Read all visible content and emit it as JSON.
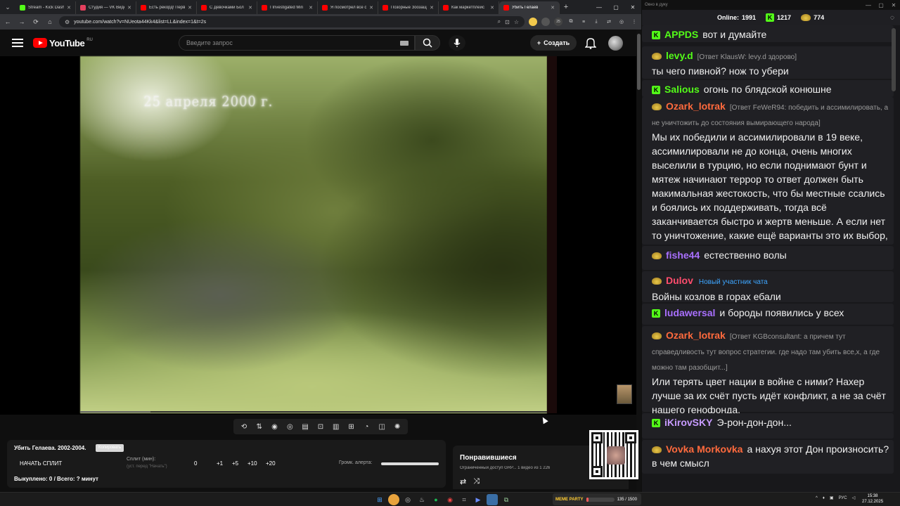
{
  "browser": {
    "tabs": [
      {
        "title": "Stream - Kick Dashboard",
        "color": "#53fc18"
      },
      {
        "title": "Студия — VK Видео",
        "color": "#e5405e"
      },
      {
        "title": "Есть рекорд! Перв",
        "color": "#ff0000"
      },
      {
        "title": "С Девочками Бол",
        "color": "#ff0000"
      },
      {
        "title": "I Investigated Min",
        "color": "#ff0000"
      },
      {
        "title": "Я посмотрел все с",
        "color": "#ff0000"
      },
      {
        "title": "Позорные Зоозащ",
        "color": "#ff0000"
      },
      {
        "title": "Как маркетплейс",
        "color": "#ff0000"
      },
      {
        "title": "Убить Гелаев",
        "color": "#ff0000",
        "active": true
      }
    ],
    "url": "youtube.com/watch?v=NUeota44Kk4&list=LL&index=1&t=2s",
    "ext_badge": "25"
  },
  "youtube": {
    "logo_text": "YouTube",
    "region": "RU",
    "search_placeholder": "Введите запрос",
    "create_label": "Создать",
    "video_overlay_date": "25 апреля 2000 г.",
    "progress_fraction": 0.15
  },
  "toolbar_icons": [
    "loop-icon",
    "sort-icon",
    "broadcast-icon",
    "eye-camera-icon",
    "clapper-icon",
    "resize-icon",
    "subtitles-icon",
    "add-box-icon",
    "speed-icon",
    "screenshot-icon",
    "settings-icon"
  ],
  "auction_panel": {
    "title": "Убить Гелаева. 2002-2004.",
    "badge": "Копировать",
    "split_button": "НАЧАТЬ СПЛИТ",
    "split_label": "Сплит (мин):",
    "split_hint": "(уст. перед \"Начать\")",
    "split_values": [
      "0",
      "+1",
      "+5",
      "+10",
      "+20"
    ],
    "volume_label": "Громк. алерта:",
    "volume_fraction": 1.0,
    "bought": "Выкуплено: 0 / Всего: ? минут"
  },
  "liked_panel": {
    "title": "Понравившиеся",
    "subtitle": "Ограниченный доступ GRP... 1 видео из 1 226"
  },
  "chat": {
    "window_title": "Окно в дуку",
    "online_label": "Online:",
    "online_count": "1991",
    "kick_count": "1217",
    "pepe_count": "774",
    "messages": [
      {
        "badge": "kick",
        "nick": "APPDS",
        "nick_color": "#53fc18",
        "text": "вот и думайте"
      },
      {
        "badge": "pepe",
        "nick": "levy.d",
        "nick_color": "#53fc18",
        "reply": "[Ответ KlausW: levy.d здорово]",
        "text": "ты чего пивной? нож то убери"
      },
      {
        "badge": "kick",
        "nick": "Salious",
        "nick_color": "#53fc18",
        "text": "огонь по блядской конюшне"
      },
      {
        "badge": "pepe",
        "nick": "Ozark_lotrak",
        "nick_color": "#ff6a3d",
        "reply": "[Ответ FeWeR94: победить и ассимилировать, а не уничтожить до состояния вымирающего народа]",
        "text": "Мы их победили и ассимилировали в 19 веке, ассимилировали не до конца, очень многих выселили в турцию, но если поднимают бунт и мятеж начинают террор то ответ должен быть макимальная жестокость, что бы местные ссались и боялись их поддерживать, тогда всё заканчивается быстро и жертв меньше. А если нет то уничтожение, какие ещё варианты это их выбор, или каждому такому террористу сдаваться?"
      },
      {
        "badge": "pepe",
        "nick": "fishe44",
        "nick_color": "#a970ff",
        "text": "естественно волы"
      },
      {
        "badge": "pepe",
        "nick": "Dulov",
        "nick_color": "#ff4d6d",
        "newbie": "Новый участник чата",
        "text": "Войны козлов в горах ебали"
      },
      {
        "badge": "kick",
        "nick": "ludawersal",
        "nick_color": "#a970ff",
        "text": "и бороды появились у всех"
      },
      {
        "badge": "pepe",
        "nick": "Ozark_lotrak",
        "nick_color": "#ff6a3d",
        "reply": "[Ответ KGBconsultant: а причем тут справедливость тут вопрос стратегии. где надо там убить все,х, а где можно там разобщит...]",
        "text": "Или терять цвет нации в войне с ними? Нахер лучше за их счёт пусть идёт конфликт, а не за счёт нашего генофонда."
      },
      {
        "badge": "kick",
        "nick": "iKirovSKY",
        "nick_color": "#c79bff",
        "text": "Э-рон-дон-дон..."
      },
      {
        "badge": "pepe",
        "nick": "Vovka Morkovka",
        "nick_color": "#ff6a3d",
        "text": "а нахуя этот Дон произносить? в чем смысл"
      }
    ]
  },
  "taskbar": {
    "widget_label": "MEME PARTY",
    "widget_counter": "135 / 1500",
    "widget_fraction": 0.09,
    "lang": "РУС",
    "time": "15:38",
    "date": "27.12.2025"
  }
}
